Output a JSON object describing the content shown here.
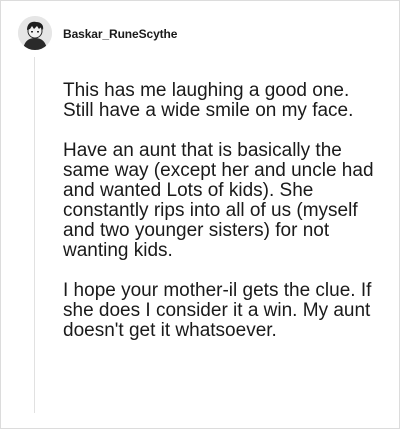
{
  "comment": {
    "username": "Baskar_RuneScythe",
    "avatar_icon": "avatar-icon",
    "paragraphs": [
      "This has me laughing a good one. Still have a wide smile on my face.",
      "Have an aunt that is basically the same way (except her and uncle had and wanted Lots of kids). She constantly rips into all of us (myself and two younger sisters) for not wanting kids.",
      "I hope your mother-il gets the clue. If she does I consider it a win. My aunt doesn't get it whatsoever."
    ]
  },
  "colors": {
    "text": "#1a1a1a",
    "border": "#dcdcdc",
    "thread_line": "#e1e1e1"
  }
}
